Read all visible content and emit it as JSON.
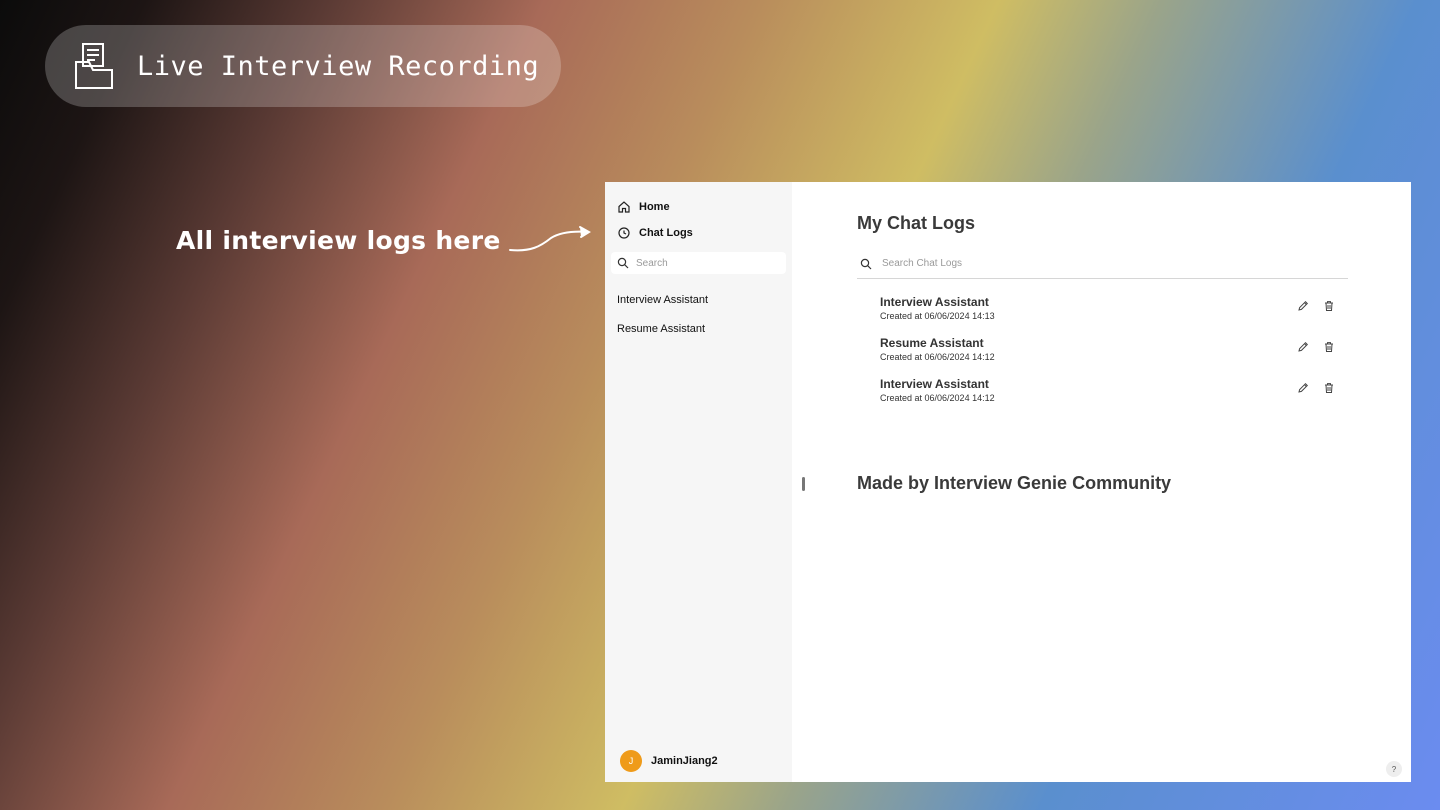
{
  "banner": {
    "title": "Live Interview Recording",
    "icon": "inbox-document-icon"
  },
  "annotation": {
    "text": "All interview logs here",
    "arrow": "curved-arrow-icon"
  },
  "sidebar": {
    "nav": [
      {
        "label": "Home",
        "icon": "home-icon"
      },
      {
        "label": "Chat Logs",
        "icon": "history-icon"
      }
    ],
    "search": {
      "placeholder": "Search"
    },
    "items": [
      {
        "label": "Interview Assistant"
      },
      {
        "label": "Resume Assistant"
      }
    ],
    "user": {
      "initial": "J",
      "name": "JaminJiang2",
      "avatar_color": "#ef9b1a"
    }
  },
  "main": {
    "title": "My Chat Logs",
    "search": {
      "placeholder": "Search Chat Logs"
    },
    "logs": [
      {
        "title": "Interview Assistant",
        "created": "Created at 06/06/2024 14:13"
      },
      {
        "title": "Resume Assistant",
        "created": "Created at 06/06/2024 14:12"
      },
      {
        "title": "Interview Assistant",
        "created": "Created at 06/06/2024 14:12"
      }
    ],
    "footer": "Made by Interview Genie Community",
    "help": "?"
  }
}
